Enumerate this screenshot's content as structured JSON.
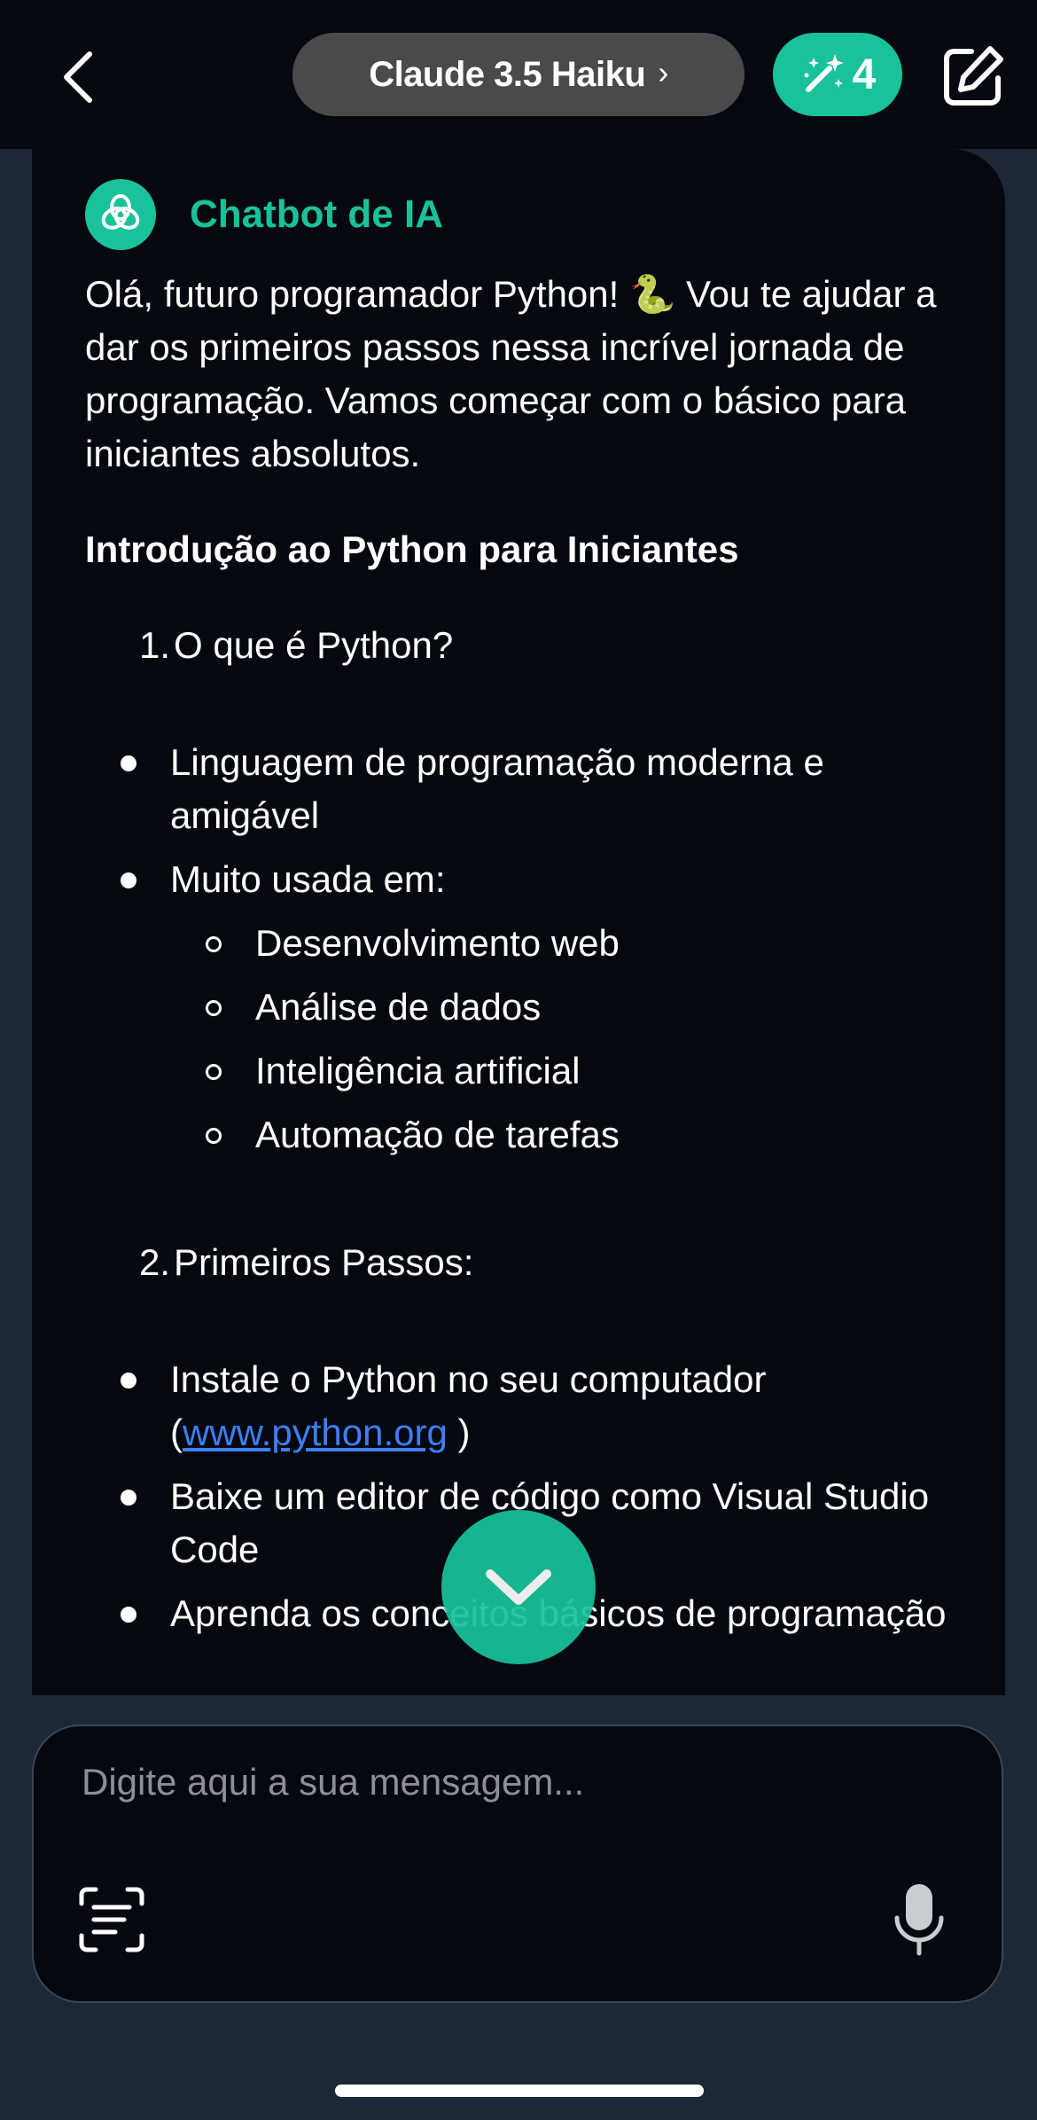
{
  "header": {
    "model_name": "Claude 3.5 Haiku",
    "model_chevron": "›",
    "credits": "4",
    "icons": {
      "back": "chevron-left-icon",
      "magic": "magic-wand-icon",
      "edit": "edit-icon"
    }
  },
  "chat": {
    "bot_name": "Chatbot de IA",
    "intro": "Olá, futuro programador Python! 🐍  Vou te ajudar a dar os primeiros passos nessa incrível jornada de programação. Vamos começar com o básico para iniciantes absolutos.",
    "heading": "Introdução ao Python para Iniciantes",
    "section1": {
      "num": "1.",
      "title": "O que é Python?",
      "bullet1": "Linguagem de programação moderna e amigável",
      "bullet2": "Muito usada em:",
      "sub": [
        "Desenvolvimento web",
        "Análise de dados",
        "Inteligência artificial",
        "Automação de tarefas"
      ]
    },
    "section2": {
      "num": "2.",
      "title": "Primeiros Passos:",
      "bullet1_pre": "Instale o Python no seu computador (",
      "bullet1_link": "www.python.org",
      "bullet1_post": " )",
      "bullet2": "Baixe um editor de código como Visual Studio Code",
      "bullet3": "Aprenda os conceitos básicos de programação"
    }
  },
  "input": {
    "placeholder": "Digite aqui a sua mensagem..."
  },
  "colors": {
    "accent": "#19c29a",
    "background": "#05090f",
    "link": "#3d7ef5"
  }
}
